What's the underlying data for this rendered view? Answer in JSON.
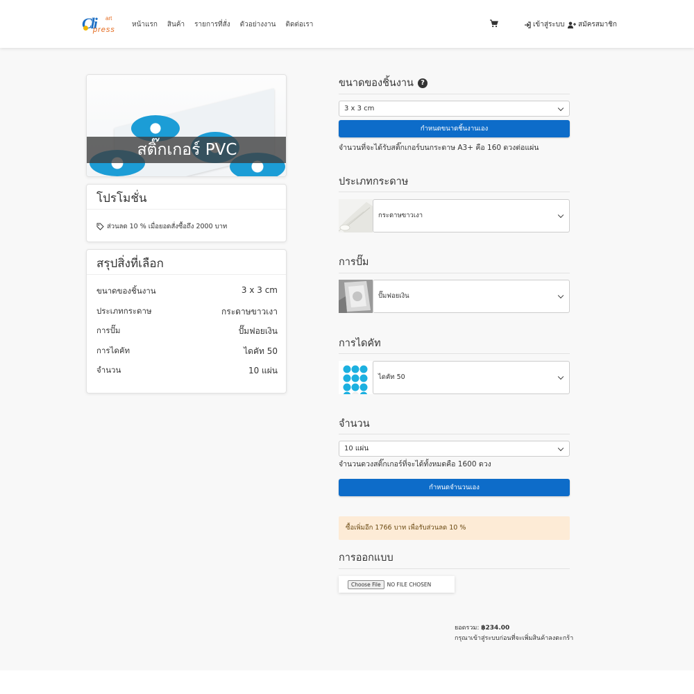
{
  "nav": {
    "logo_mark": "Cli",
    "logo_word_top": "art",
    "logo_word_bottom": "press",
    "menu": [
      "หน้าแรก",
      "สินค้า",
      "รายการที่สั่ง",
      "ตัวอย่างงาน",
      "ติดต่อเรา"
    ],
    "login": "เข้าสู่ระบบ",
    "register": "สมัครสมาชิก"
  },
  "product": {
    "title": "สติ๊กเกอร์ PVC"
  },
  "promotion": {
    "heading": "โปรโมชั่น",
    "text": "ส่วนลด 10 % เมื่อยอดสั่งซื้อถึง 2000 บาท"
  },
  "summary": {
    "heading": "สรุปสิ่งที่เลือก",
    "rows": [
      {
        "label": "ขนาดของชิ้นงาน",
        "value": "3 x 3 cm"
      },
      {
        "label": "ประเภทกระดาษ",
        "value": "กระดาษขาวเงา"
      },
      {
        "label": "การปั๊ม",
        "value": "ปั๊มฟอยเงิน"
      },
      {
        "label": "การไดคัท",
        "value": "ไดคัท 50"
      },
      {
        "label": "จำนวน",
        "value": "10 แผ่น"
      }
    ]
  },
  "size": {
    "heading": "ขนาดของชิ้นงาน",
    "selected": "3 x 3 cm",
    "custom_button": "กำหนดขนาดชิ้นงานเอง",
    "note": "จำนวนที่จะได้รับสติ๊กเกอร์บนกระดาษ A3+ คือ 160 ดวงต่อแผ่น"
  },
  "paper": {
    "heading": "ประเภทกระดาษ",
    "selected": "กระดาษขาวเงา"
  },
  "stamp": {
    "heading": "การปั๊ม",
    "selected": "ปั๊มฟอยเงิน"
  },
  "diecut": {
    "heading": "การไดคัท",
    "selected": "ไดคัท 50"
  },
  "quantity": {
    "heading": "จำนวน",
    "selected": "10 แผ่น",
    "note": "จำนวนดวงสติ๊กเกอร์ที่จะได้ทั้งหมดคือ 1600 ดวง",
    "custom_button": "กำหนดจำนวนเอง"
  },
  "alert": "ซื้อเพิ่มอีก 1766 บาท เพื่อรับส่วนลด 10 %",
  "design": {
    "heading": "การออกแบบ",
    "file_button": "Choose File",
    "file_status": "NO FILE CHOSEN"
  },
  "total": {
    "label": "ยอดรวม:",
    "amount": "฿234.00",
    "note": "กรุณาเข้าสู่ระบบก่อนที่จะเพิ่มสินค้าลงตะกร้า"
  },
  "colors": {
    "primary_button": "#0d6cc9",
    "alert_bg": "#fdebd6",
    "sticker_blue": "#1c9dd6"
  }
}
